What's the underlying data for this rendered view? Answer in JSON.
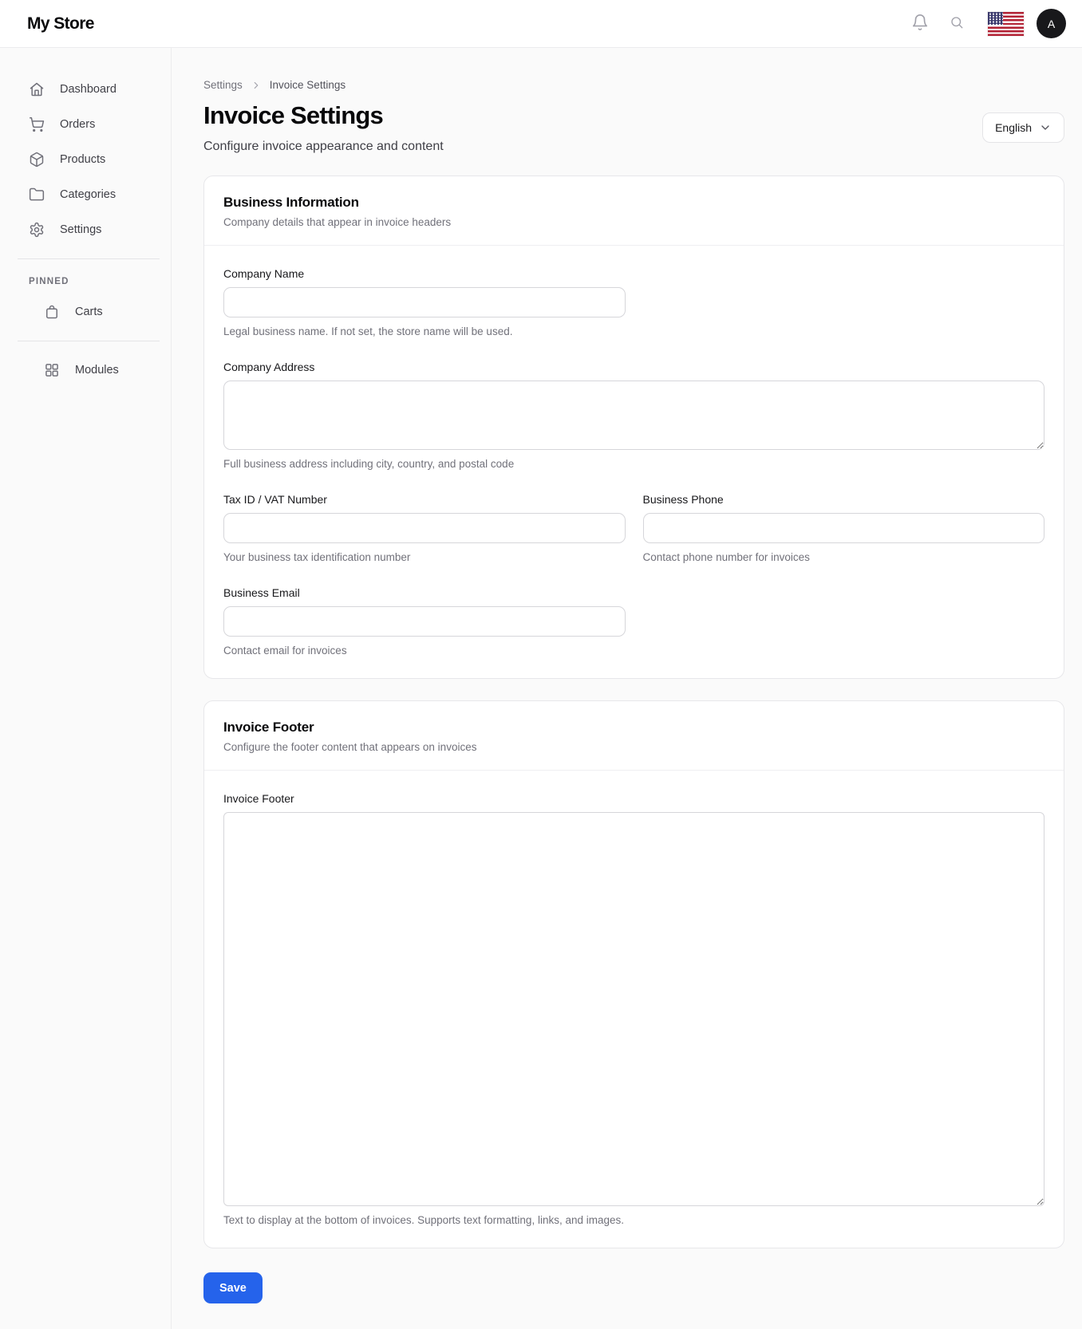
{
  "header": {
    "brand": "My Store",
    "avatar_initial": "A"
  },
  "sidebar": {
    "items": [
      {
        "label": "Dashboard",
        "icon": "home-icon"
      },
      {
        "label": "Orders",
        "icon": "cart-icon"
      },
      {
        "label": "Products",
        "icon": "package-icon"
      },
      {
        "label": "Categories",
        "icon": "folder-icon"
      },
      {
        "label": "Settings",
        "icon": "gear-icon"
      }
    ],
    "pinned_label": "PINNED",
    "pinned_items": [
      {
        "label": "Carts",
        "icon": "shopping-bag-icon"
      }
    ],
    "bottom_items": [
      {
        "label": "Modules",
        "icon": "grid-icon"
      }
    ]
  },
  "page": {
    "breadcrumb": [
      "Settings",
      "Invoice Settings"
    ],
    "title": "Invoice Settings",
    "subtitle": "Configure invoice appearance and content",
    "language_selector": "English"
  },
  "business_info": {
    "title": "Business Information",
    "subtitle": "Company details that appear in invoice headers",
    "fields": {
      "company_name": {
        "label": "Company Name",
        "value": "",
        "helper": "Legal business name. If not set, the store name will be used."
      },
      "company_address": {
        "label": "Company Address",
        "value": "",
        "helper": "Full business address including city, country, and postal code"
      },
      "tax_id": {
        "label": "Tax ID / VAT Number",
        "value": "",
        "helper": "Your business tax identification number"
      },
      "business_phone": {
        "label": "Business Phone",
        "value": "",
        "helper": "Contact phone number for invoices"
      },
      "business_email": {
        "label": "Business Email",
        "value": "",
        "helper": "Contact email for invoices"
      }
    }
  },
  "invoice_footer": {
    "title": "Invoice Footer",
    "subtitle": "Configure the footer content that appears on invoices",
    "fields": {
      "invoice_footer": {
        "label": "Invoice Footer",
        "value": "",
        "helper": "Text to display at the bottom of invoices. Supports text formatting, links, and images."
      }
    }
  },
  "actions": {
    "save_label": "Save"
  },
  "colors": {
    "accent": "#2563eb",
    "avatar_bg": "#18181b",
    "flag_red": "#b22234",
    "flag_blue": "#3c3b6e"
  }
}
